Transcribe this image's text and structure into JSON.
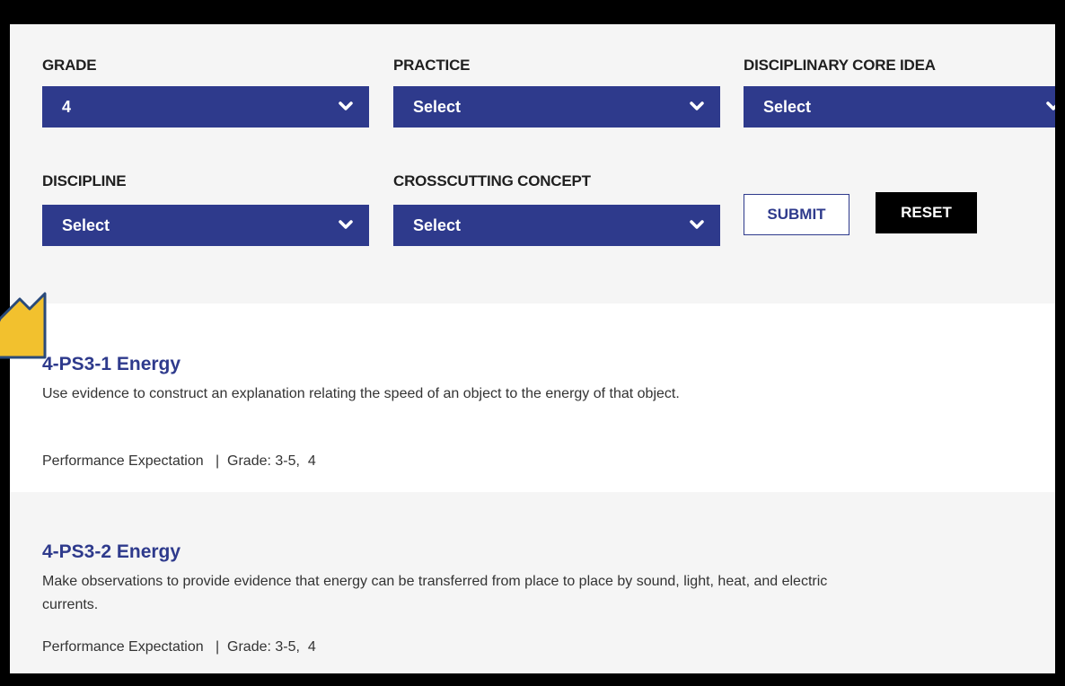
{
  "filters": {
    "grade": {
      "label": "GRADE",
      "value": "4"
    },
    "practice": {
      "label": "PRACTICE",
      "value": "Select"
    },
    "dci": {
      "label": "DISCIPLINARY CORE IDEA",
      "value": "Select"
    },
    "discipline": {
      "label": "DISCIPLINE",
      "value": "Select"
    },
    "crosscutting": {
      "label": "CROSSCUTTING CONCEPT",
      "value": "Select"
    },
    "submit_label": "SUBMIT",
    "reset_label": "RESET"
  },
  "results": [
    {
      "title": "4-PS3-1 Energy",
      "description": "Use evidence to construct an explanation relating the speed of an object to the energy of that object.",
      "meta": "Performance Expectation   |  Grade: 3-5,  4"
    },
    {
      "title": "4-PS3-2 Energy",
      "description": "Make observations to provide evidence that energy can be transferred from place to place by sound, light, heat, and electric currents.",
      "meta": "Performance Expectation   |  Grade: 3-5,  4"
    }
  ],
  "colors": {
    "accent": "#2e3a8c",
    "pointer_arrow": "#f2c12e"
  },
  "icons": {
    "dropdown": "chevron-down-icon",
    "pointer": "pointer-arrow-icon"
  }
}
